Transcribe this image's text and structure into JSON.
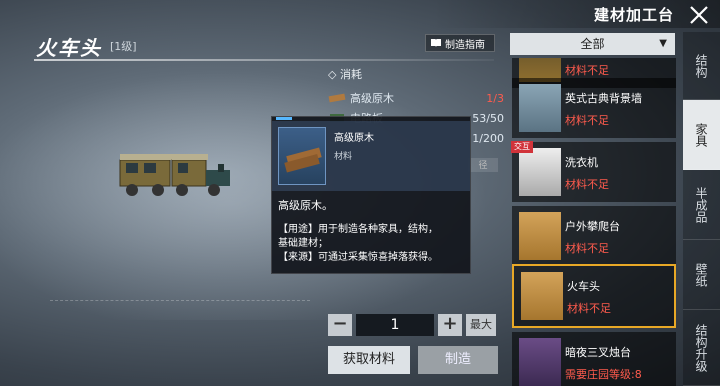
{
  "header": {
    "title": "建材加工台",
    "item_name": "火车头",
    "item_level": "[1级]",
    "guide_label": "制造指南"
  },
  "consumption": {
    "heading": "消耗",
    "materials": [
      {
        "name": "高级原木",
        "count": "1/3",
        "short": true
      },
      {
        "name": "电路板",
        "count": "53/50",
        "short": false
      },
      {
        "name": "",
        "count": "1/200",
        "short": false
      }
    ],
    "hint_label": "径"
  },
  "tooltip": {
    "name": "高级原木",
    "type": "材料",
    "desc": "高级原木。",
    "use_line1": "【用途】用于制造各种家具，结构，",
    "use_line2": "基础建材；",
    "source_line": "【来源】可通过采集惊喜掉落获得。"
  },
  "controls": {
    "minus": "−",
    "quantity": "1",
    "plus": "+",
    "max_label": "最大",
    "get_materials": "获取材料",
    "craft": "制造"
  },
  "filter": {
    "selected": "全部"
  },
  "items": [
    {
      "name": "",
      "status": "材料不足"
    },
    {
      "name": "英式古典背景墙",
      "status": "材料不足"
    },
    {
      "name": "洗衣机",
      "status": "材料不足",
      "badge": "交互"
    },
    {
      "name": "户外攀爬台",
      "status": "材料不足"
    },
    {
      "name": "火车头",
      "status": "材料不足"
    },
    {
      "name": "暗夜三叉烛台",
      "status": "需要庄园等级:8"
    }
  ],
  "tabs": [
    {
      "label": "结构"
    },
    {
      "label": "家具"
    },
    {
      "label": "半成品"
    },
    {
      "label": "壁纸"
    },
    {
      "label": "结构升级"
    }
  ],
  "colors": {
    "accent": "#e8a826",
    "warning": "#ff5b4d",
    "tooltip_accent": "#57b8ff"
  }
}
